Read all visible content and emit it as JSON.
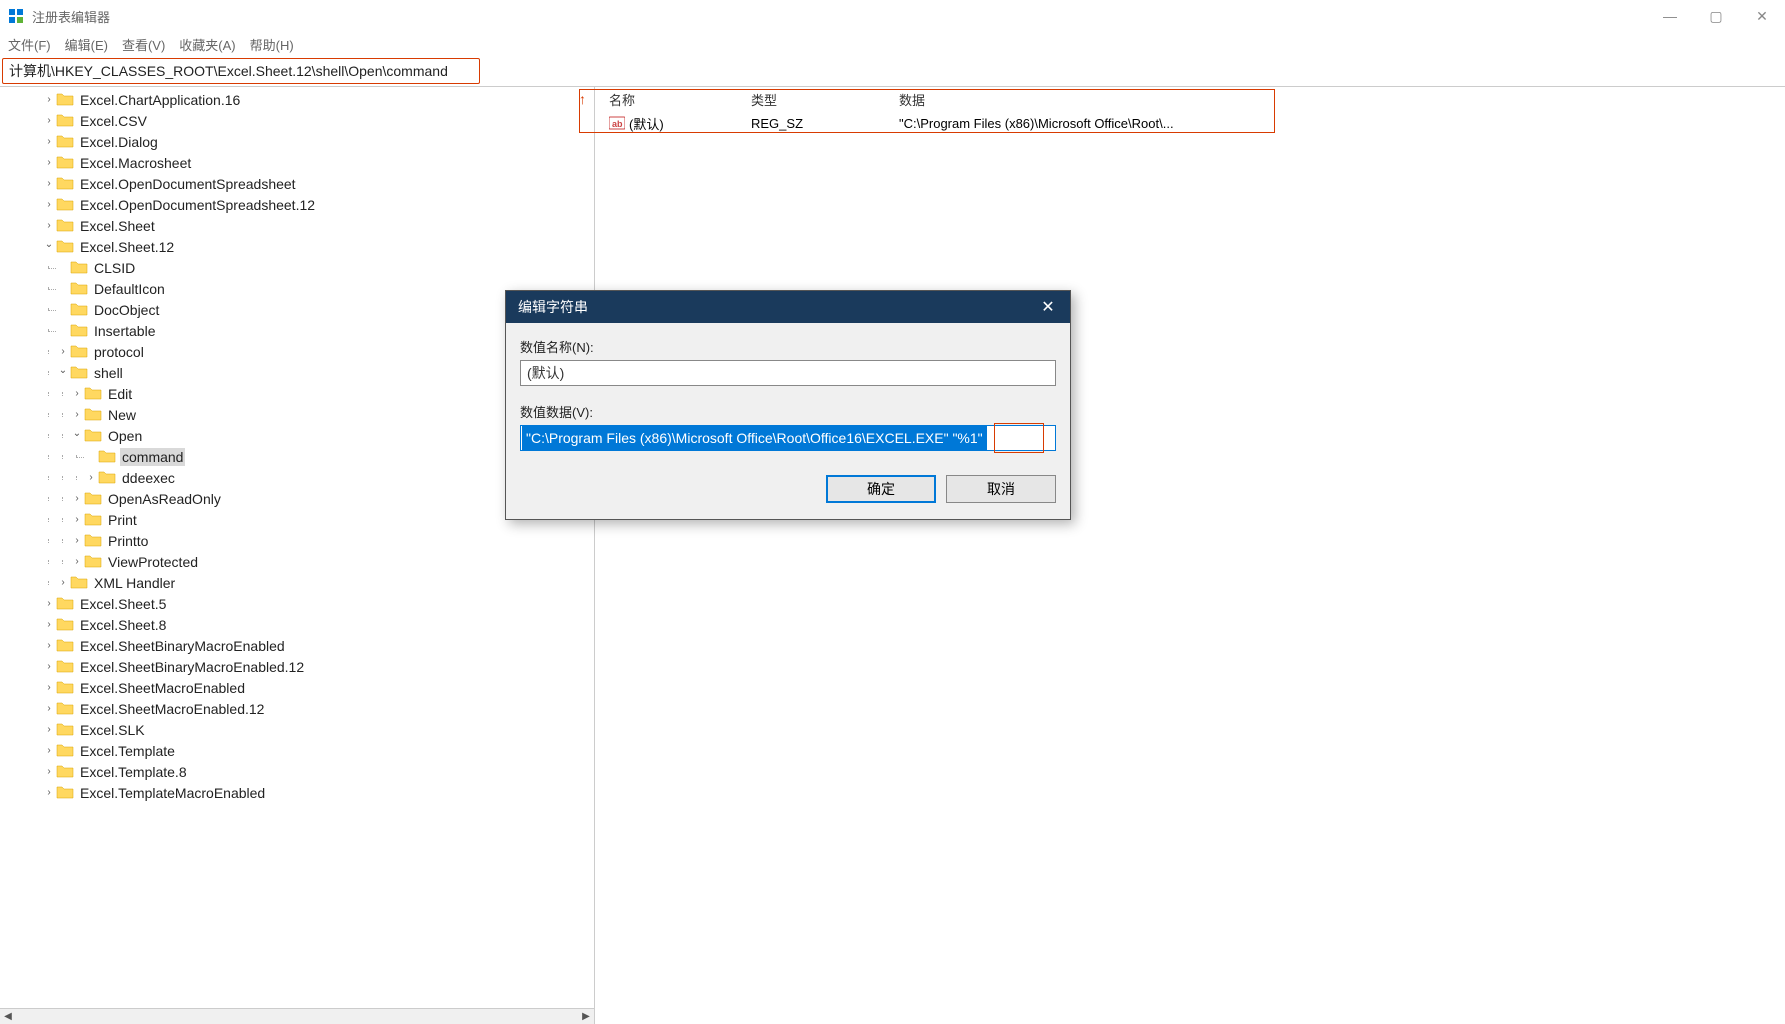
{
  "app": {
    "title": "注册表编辑器"
  },
  "menu": {
    "file": "文件(F)",
    "edit": "编辑(E)",
    "view": "查看(V)",
    "favorites": "收藏夹(A)",
    "help": "帮助(H)"
  },
  "address": {
    "path": "计算机\\HKEY_CLASSES_ROOT\\Excel.Sheet.12\\shell\\Open\\command"
  },
  "tree": [
    {
      "indent": 3,
      "exp": "h",
      "label": "Excel.ChartApplication.16"
    },
    {
      "indent": 3,
      "exp": "h",
      "label": "Excel.CSV"
    },
    {
      "indent": 3,
      "exp": "h",
      "label": "Excel.Dialog"
    },
    {
      "indent": 3,
      "exp": "h",
      "label": "Excel.Macrosheet"
    },
    {
      "indent": 3,
      "exp": "h",
      "label": "Excel.OpenDocumentSpreadsheet"
    },
    {
      "indent": 3,
      "exp": "h",
      "label": "Excel.OpenDocumentSpreadsheet.12"
    },
    {
      "indent": 3,
      "exp": "h",
      "label": "Excel.Sheet"
    },
    {
      "indent": 3,
      "exp": "v",
      "label": "Excel.Sheet.12"
    },
    {
      "indent": 4,
      "exp": "none",
      "label": "CLSID",
      "tee": true
    },
    {
      "indent": 4,
      "exp": "none",
      "label": "DefaultIcon",
      "tee": true
    },
    {
      "indent": 4,
      "exp": "none",
      "label": "DocObject",
      "tee": true
    },
    {
      "indent": 4,
      "exp": "none",
      "label": "Insertable",
      "tee": true
    },
    {
      "indent": 4,
      "exp": "h",
      "label": "protocol"
    },
    {
      "indent": 4,
      "exp": "v",
      "label": "shell"
    },
    {
      "indent": 5,
      "exp": "h",
      "label": "Edit"
    },
    {
      "indent": 5,
      "exp": "h",
      "label": "New"
    },
    {
      "indent": 5,
      "exp": "v",
      "label": "Open"
    },
    {
      "indent": 6,
      "exp": "none",
      "label": "command",
      "selected": true,
      "tee": true
    },
    {
      "indent": 6,
      "exp": "h",
      "label": "ddeexec"
    },
    {
      "indent": 5,
      "exp": "h",
      "label": "OpenAsReadOnly"
    },
    {
      "indent": 5,
      "exp": "h",
      "label": "Print"
    },
    {
      "indent": 5,
      "exp": "h",
      "label": "Printto"
    },
    {
      "indent": 5,
      "exp": "h",
      "label": "ViewProtected"
    },
    {
      "indent": 4,
      "exp": "h",
      "label": "XML Handler"
    },
    {
      "indent": 3,
      "exp": "h",
      "label": "Excel.Sheet.5"
    },
    {
      "indent": 3,
      "exp": "h",
      "label": "Excel.Sheet.8"
    },
    {
      "indent": 3,
      "exp": "h",
      "label": "Excel.SheetBinaryMacroEnabled"
    },
    {
      "indent": 3,
      "exp": "h",
      "label": "Excel.SheetBinaryMacroEnabled.12"
    },
    {
      "indent": 3,
      "exp": "h",
      "label": "Excel.SheetMacroEnabled"
    },
    {
      "indent": 3,
      "exp": "h",
      "label": "Excel.SheetMacroEnabled.12"
    },
    {
      "indent": 3,
      "exp": "h",
      "label": "Excel.SLK"
    },
    {
      "indent": 3,
      "exp": "h",
      "label": "Excel.Template"
    },
    {
      "indent": 3,
      "exp": "h",
      "label": "Excel.Template.8"
    },
    {
      "indent": 3,
      "exp": "h",
      "label": "Excel.TemplateMacroEnabled"
    }
  ],
  "details": {
    "columns": {
      "name": "名称",
      "type": "类型",
      "data": "数据"
    },
    "rows": [
      {
        "name": "(默认)",
        "type": "REG_SZ",
        "data": "\"C:\\Program Files (x86)\\Microsoft Office\\Root\\..."
      }
    ]
  },
  "dialog": {
    "title": "编辑字符串",
    "name_label": "数值名称(N):",
    "name_value": "(默认)",
    "data_label": "数值数据(V):",
    "data_value": "\"C:\\Program Files (x86)\\Microsoft Office\\Root\\Office16\\EXCEL.EXE\" \"%1\"",
    "ok": "确定",
    "cancel": "取消"
  }
}
